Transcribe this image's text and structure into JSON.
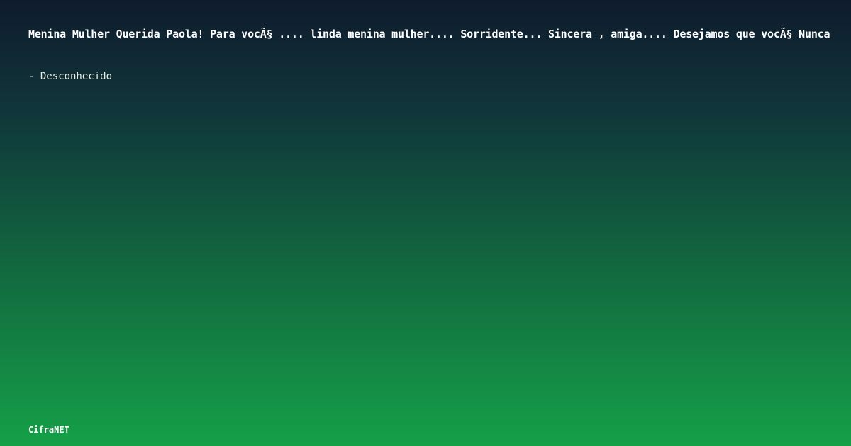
{
  "quote": {
    "text": "Menina Mulher Querida Paola! Para vocÃ§ .... linda menina mulher.... Sorridente... Sincera , amiga.... Desejamos que vocÃ§ Nunca"
  },
  "author": {
    "text": "- Desconhecido"
  },
  "brand": {
    "name": "CifraNET"
  },
  "colors": {
    "gradient_top": "#0f1b2d",
    "gradient_bottom": "#15a048",
    "text": "#ffffff"
  }
}
